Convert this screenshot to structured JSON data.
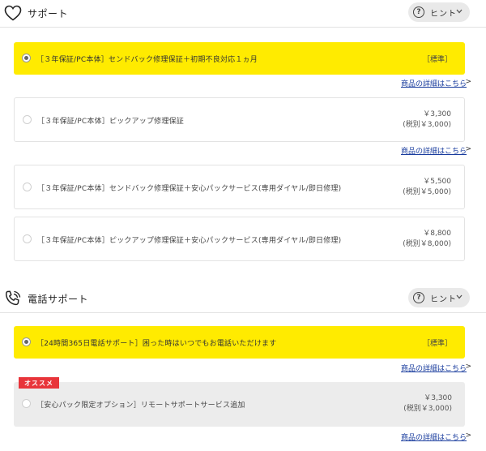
{
  "support": {
    "title": "サポート",
    "hint_label": "ヒント",
    "options": [
      {
        "label": "［３年保証/PC本体］センドバック修理保証＋初期不良対応１ヵ月",
        "tag": "［標準］",
        "selected": true
      },
      {
        "label": "［３年保証/PC本体］ピックアップ修理保証",
        "price": "￥3,300",
        "price_tax": "(税別￥3,000)",
        "selected": false
      },
      {
        "label": "［３年保証/PC本体］センドバック修理保証＋安心パックサービス(専用ダイヤル/即日修理)",
        "price": "￥5,500",
        "price_tax": "(税別￥5,000)",
        "selected": false
      },
      {
        "label": "［３年保証/PC本体］ピックアップ修理保証＋安心パックサービス(専用ダイヤル/即日修理)",
        "price": "￥8,800",
        "price_tax": "(税別￥8,000)",
        "selected": false
      }
    ],
    "detail_link": "商品の詳細はこちら"
  },
  "phone_support": {
    "title": "電話サポート",
    "hint_label": "ヒント",
    "options": [
      {
        "label": "［24時間365日電話サポート］困った時はいつでもお電話いただけます",
        "tag": "［標準］",
        "selected": true
      },
      {
        "label": "［安心パック限定オプション］リモートサポートサービス追加",
        "price": "￥3,300",
        "price_tax": "(税別￥3,000)",
        "badge": "オススメ",
        "selected": false
      }
    ],
    "detail_link": "商品の詳細はこちら"
  },
  "chevron_glyph": ">",
  "colors": {
    "selected_bg": "#ffeb00",
    "link": "#1a3d9e",
    "badge": "#e8343a"
  }
}
